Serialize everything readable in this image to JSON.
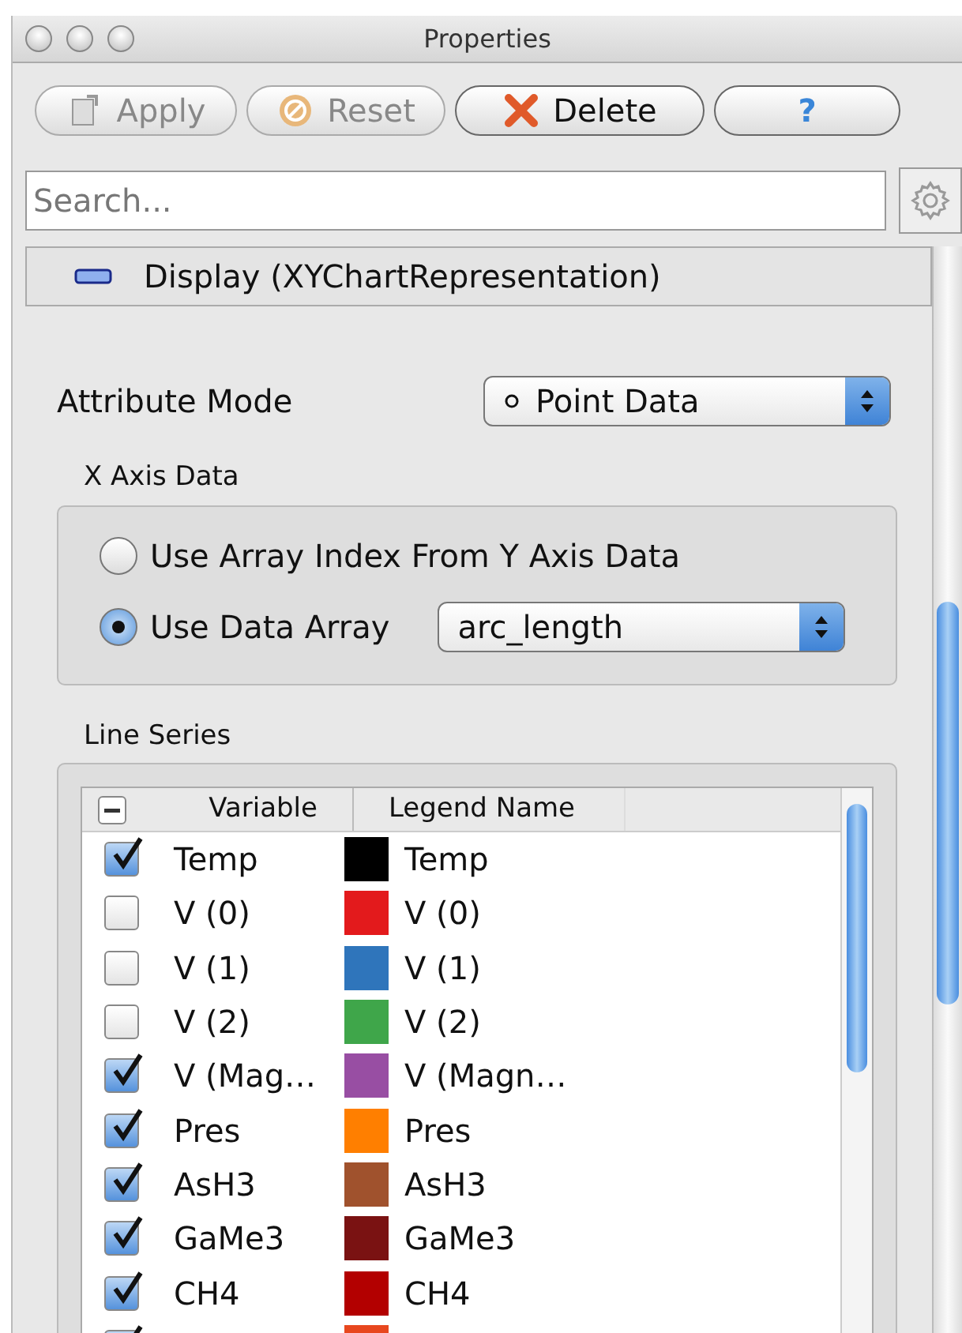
{
  "window": {
    "title": "Properties"
  },
  "toolbar": [
    {
      "label": "Apply",
      "kind": "apply",
      "disabled": true
    },
    {
      "label": "Reset",
      "kind": "reset",
      "disabled": true
    },
    {
      "label": "Delete",
      "kind": "delete",
      "disabled": false
    },
    {
      "label": "?",
      "kind": "help",
      "disabled": false
    }
  ],
  "search": {
    "placeholder": "Search..."
  },
  "section": {
    "title": "Display (XYChartRepresentation)",
    "expanded": true
  },
  "attribute_mode": {
    "label": "Attribute Mode",
    "value": "Point Data"
  },
  "x_axis_data": {
    "title": "X Axis Data",
    "array": "arc_length",
    "options": [
      {
        "label": "Use Array Index From Y Axis Data",
        "selected": false
      },
      {
        "label": "Use Data Array",
        "selected": true
      }
    ]
  },
  "line_series": {
    "title": "Line Series",
    "header_mixed": true,
    "columns": [
      "Variable",
      "Legend Name"
    ],
    "rows": [
      {
        "variable": "Temp",
        "legend": "Temp",
        "checked": true,
        "color": "#000000"
      },
      {
        "variable": "V (0)",
        "legend": "V (0)",
        "checked": false,
        "color": "#e31a1c"
      },
      {
        "variable": "V (1)",
        "legend": "V (1)",
        "checked": false,
        "color": "#2f75bb"
      },
      {
        "variable": "V (2)",
        "legend": "V (2)",
        "checked": false,
        "color": "#3fa64a"
      },
      {
        "variable": "V (Mag…",
        "legend": "V (Magn…",
        "checked": true,
        "color": "#984ea3"
      },
      {
        "variable": "Pres",
        "legend": "Pres",
        "checked": true,
        "color": "#ff7f00"
      },
      {
        "variable": "AsH3",
        "legend": "AsH3",
        "checked": true,
        "color": "#a0522d"
      },
      {
        "variable": "GaMe3",
        "legend": "GaMe3",
        "checked": true,
        "color": "#7a1212"
      },
      {
        "variable": "CH4",
        "legend": "CH4",
        "checked": true,
        "color": "#b30000"
      },
      {
        "checked": true,
        "color": "#e8471e"
      }
    ]
  }
}
